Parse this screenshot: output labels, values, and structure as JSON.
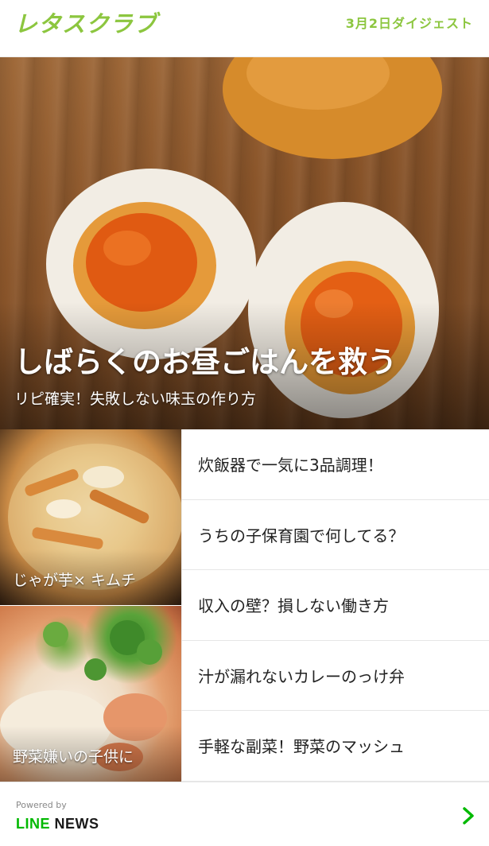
{
  "header": {
    "brand": "レタスクラブ",
    "digest_label": "3月2日ダイジェスト"
  },
  "hero": {
    "title": "しばらくのお昼ごはんを救う",
    "subtitle": "リピ確実！失敗しない味玉の作り方"
  },
  "thumbnails": [
    {
      "caption": "じゃが芋× キムチ"
    },
    {
      "caption": "野菜嫌いの子供に"
    }
  ],
  "headlines": [
    {
      "title": "炊飯器で一気に3品調理！"
    },
    {
      "title": "うちの子保育園で何してる？"
    },
    {
      "title": "収入の壁？損しない働き方"
    },
    {
      "title": "汁が漏れないカレーのっけ弁"
    },
    {
      "title": "手軽な副菜！野菜のマッシュ"
    }
  ],
  "footer": {
    "powered_by": "Powered by",
    "line_part": "LINE",
    "news_part": " NEWS",
    "chevron_icon": "chevron-right-icon"
  },
  "colors": {
    "brand_green": "#8cc63f",
    "line_green": "#00b900"
  }
}
